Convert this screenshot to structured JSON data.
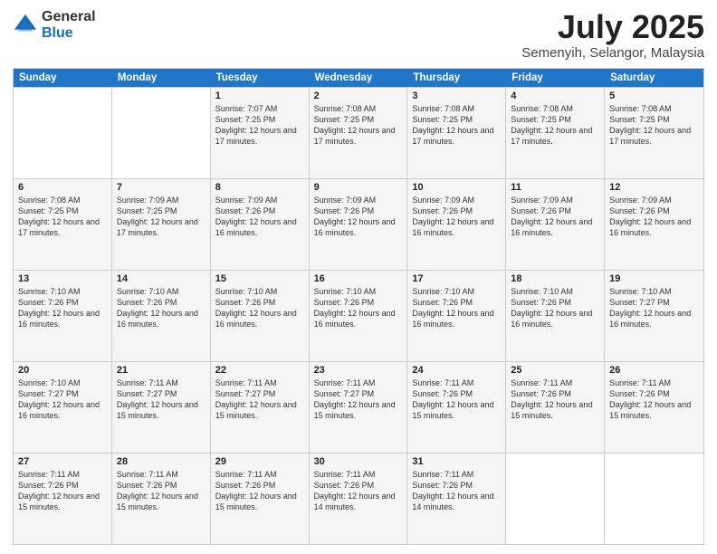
{
  "logo": {
    "general": "General",
    "blue": "Blue"
  },
  "title": {
    "month_year": "July 2025",
    "location": "Semenyih, Selangor, Malaysia"
  },
  "calendar": {
    "headers": [
      "Sunday",
      "Monday",
      "Tuesday",
      "Wednesday",
      "Thursday",
      "Friday",
      "Saturday"
    ],
    "rows": [
      [
        {
          "day": "",
          "info": "",
          "empty": true
        },
        {
          "day": "",
          "info": "",
          "empty": true
        },
        {
          "day": "1",
          "info": "Sunrise: 7:07 AM\nSunset: 7:25 PM\nDaylight: 12 hours and 17 minutes."
        },
        {
          "day": "2",
          "info": "Sunrise: 7:08 AM\nSunset: 7:25 PM\nDaylight: 12 hours and 17 minutes."
        },
        {
          "day": "3",
          "info": "Sunrise: 7:08 AM\nSunset: 7:25 PM\nDaylight: 12 hours and 17 minutes."
        },
        {
          "day": "4",
          "info": "Sunrise: 7:08 AM\nSunset: 7:25 PM\nDaylight: 12 hours and 17 minutes."
        },
        {
          "day": "5",
          "info": "Sunrise: 7:08 AM\nSunset: 7:25 PM\nDaylight: 12 hours and 17 minutes."
        }
      ],
      [
        {
          "day": "6",
          "info": "Sunrise: 7:08 AM\nSunset: 7:25 PM\nDaylight: 12 hours and 17 minutes."
        },
        {
          "day": "7",
          "info": "Sunrise: 7:09 AM\nSunset: 7:25 PM\nDaylight: 12 hours and 17 minutes."
        },
        {
          "day": "8",
          "info": "Sunrise: 7:09 AM\nSunset: 7:26 PM\nDaylight: 12 hours and 16 minutes."
        },
        {
          "day": "9",
          "info": "Sunrise: 7:09 AM\nSunset: 7:26 PM\nDaylight: 12 hours and 16 minutes."
        },
        {
          "day": "10",
          "info": "Sunrise: 7:09 AM\nSunset: 7:26 PM\nDaylight: 12 hours and 16 minutes."
        },
        {
          "day": "11",
          "info": "Sunrise: 7:09 AM\nSunset: 7:26 PM\nDaylight: 12 hours and 16 minutes."
        },
        {
          "day": "12",
          "info": "Sunrise: 7:09 AM\nSunset: 7:26 PM\nDaylight: 12 hours and 16 minutes."
        }
      ],
      [
        {
          "day": "13",
          "info": "Sunrise: 7:10 AM\nSunset: 7:26 PM\nDaylight: 12 hours and 16 minutes."
        },
        {
          "day": "14",
          "info": "Sunrise: 7:10 AM\nSunset: 7:26 PM\nDaylight: 12 hours and 16 minutes."
        },
        {
          "day": "15",
          "info": "Sunrise: 7:10 AM\nSunset: 7:26 PM\nDaylight: 12 hours and 16 minutes."
        },
        {
          "day": "16",
          "info": "Sunrise: 7:10 AM\nSunset: 7:26 PM\nDaylight: 12 hours and 16 minutes."
        },
        {
          "day": "17",
          "info": "Sunrise: 7:10 AM\nSunset: 7:26 PM\nDaylight: 12 hours and 16 minutes."
        },
        {
          "day": "18",
          "info": "Sunrise: 7:10 AM\nSunset: 7:26 PM\nDaylight: 12 hours and 16 minutes."
        },
        {
          "day": "19",
          "info": "Sunrise: 7:10 AM\nSunset: 7:27 PM\nDaylight: 12 hours and 16 minutes."
        }
      ],
      [
        {
          "day": "20",
          "info": "Sunrise: 7:10 AM\nSunset: 7:27 PM\nDaylight: 12 hours and 16 minutes."
        },
        {
          "day": "21",
          "info": "Sunrise: 7:11 AM\nSunset: 7:27 PM\nDaylight: 12 hours and 15 minutes."
        },
        {
          "day": "22",
          "info": "Sunrise: 7:11 AM\nSunset: 7:27 PM\nDaylight: 12 hours and 15 minutes."
        },
        {
          "day": "23",
          "info": "Sunrise: 7:11 AM\nSunset: 7:27 PM\nDaylight: 12 hours and 15 minutes."
        },
        {
          "day": "24",
          "info": "Sunrise: 7:11 AM\nSunset: 7:26 PM\nDaylight: 12 hours and 15 minutes."
        },
        {
          "day": "25",
          "info": "Sunrise: 7:11 AM\nSunset: 7:26 PM\nDaylight: 12 hours and 15 minutes."
        },
        {
          "day": "26",
          "info": "Sunrise: 7:11 AM\nSunset: 7:26 PM\nDaylight: 12 hours and 15 minutes."
        }
      ],
      [
        {
          "day": "27",
          "info": "Sunrise: 7:11 AM\nSunset: 7:26 PM\nDaylight: 12 hours and 15 minutes."
        },
        {
          "day": "28",
          "info": "Sunrise: 7:11 AM\nSunset: 7:26 PM\nDaylight: 12 hours and 15 minutes."
        },
        {
          "day": "29",
          "info": "Sunrise: 7:11 AM\nSunset: 7:26 PM\nDaylight: 12 hours and 15 minutes."
        },
        {
          "day": "30",
          "info": "Sunrise: 7:11 AM\nSunset: 7:26 PM\nDaylight: 12 hours and 14 minutes."
        },
        {
          "day": "31",
          "info": "Sunrise: 7:11 AM\nSunset: 7:26 PM\nDaylight: 12 hours and 14 minutes."
        },
        {
          "day": "",
          "info": "",
          "empty": true
        },
        {
          "day": "",
          "info": "",
          "empty": true
        }
      ]
    ]
  }
}
